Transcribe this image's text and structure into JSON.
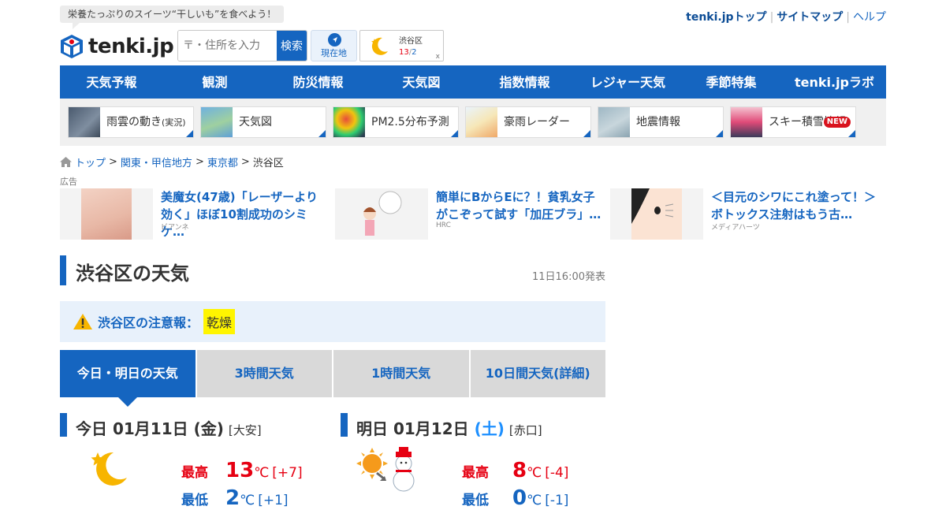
{
  "header": {
    "tagline": "栄養たっぷりのスイーツ“干しいも”を食べよう！",
    "logo_text": "tenki.jp",
    "search_placeholder": "〒・住所を入力",
    "search_button": "検索",
    "current_location": "現在地",
    "mini_weather": {
      "place": "渋谷区",
      "high": "13",
      "sep": "/",
      "low": "2",
      "close": "x"
    },
    "top_links": [
      "tenki.jpトップ",
      "サイトマップ",
      "ヘルプ"
    ]
  },
  "nav": [
    "天気予報",
    "観測",
    "防災情報",
    "天気図",
    "指数情報",
    "レジャー天気",
    "季節特集",
    "tenki.jpラボ"
  ],
  "quick_links": [
    {
      "label": "雨雲の動き",
      "small": "(実況)"
    },
    {
      "label": "天気図",
      "small": ""
    },
    {
      "label": "PM2.5分布予測",
      "small": ""
    },
    {
      "label": "豪雨レーダー",
      "small": ""
    },
    {
      "label": "地震情報",
      "small": ""
    },
    {
      "label": "スキー積雪情報",
      "small": "",
      "badge": "NEW"
    }
  ],
  "breadcrumb": [
    "トップ",
    "関東・甲信地方",
    "東京都",
    "渋谷区"
  ],
  "ads": {
    "label": "広告",
    "items": [
      {
        "text": "美魔女(47歳)「レーザーより効く」ほぼ10割成功のシミケ…",
        "source": "ビアンネ"
      },
      {
        "text": "簡単にBからEに？！貧乳女子がこぞって試す「加圧ブラ」…",
        "source": "HRC"
      },
      {
        "text": "＜目元のシワにこれ塗って！＞ボトックス注射はもう古…",
        "source": "メディアハーツ"
      }
    ]
  },
  "page": {
    "title": "渋谷区の天気",
    "issued": "11日16:00発表"
  },
  "warning": {
    "label": "渋谷区の注意報：",
    "badge": "乾燥"
  },
  "tabs": [
    "今日・明日の天気",
    "3時間天気",
    "1時間天気",
    "10日間天気(詳細)"
  ],
  "today": {
    "title": "今日 01月11日 (金)",
    "rokuyo": "[大安]",
    "high_label": "最高",
    "high": "13",
    "high_unit": "℃",
    "high_diff": "[+7]",
    "low_label": "最低",
    "low": "2",
    "low_unit": "℃",
    "low_diff": "[+1]"
  },
  "tomorrow": {
    "title_main": "明日 01月12日 ",
    "title_day": "(土)",
    "rokuyo": "[赤口]",
    "high_label": "最高",
    "high": "8",
    "high_unit": "℃",
    "high_diff": "[-4]",
    "low_label": "最低",
    "low": "0",
    "low_unit": "℃",
    "low_diff": "[-1]"
  },
  "colors": {
    "brand_blue": "#1565c0",
    "high_red": "#e60012",
    "warning_yellow": "#fff500"
  }
}
